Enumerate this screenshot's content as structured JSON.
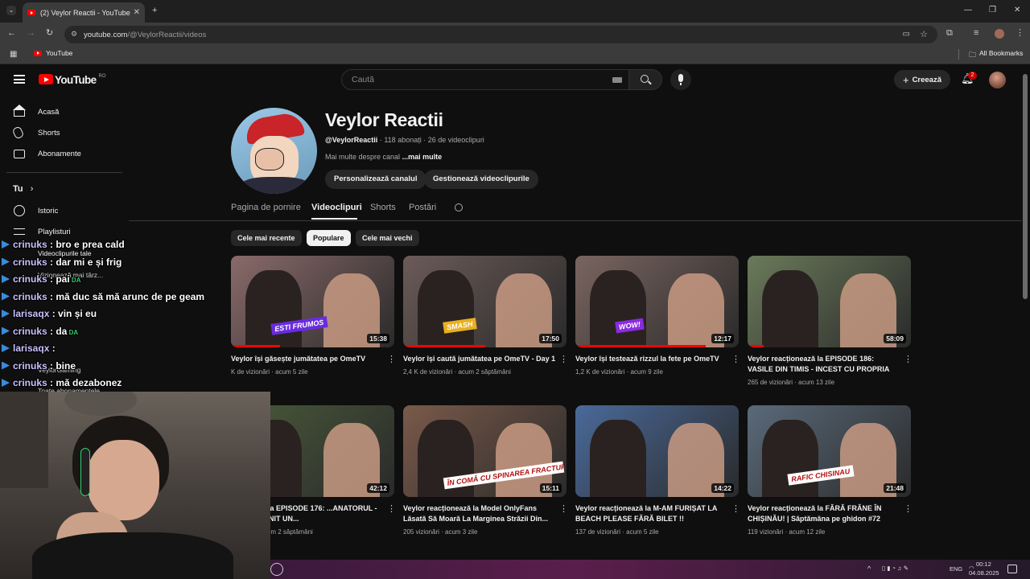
{
  "browser": {
    "tab_title": "(2) Veylor Reactii - YouTube",
    "url_host": "youtube.com",
    "url_path": "/@VeylorReactii/videos",
    "bookmark_youtube": "YouTube",
    "all_bookmarks": "All Bookmarks"
  },
  "yt": {
    "logo_text": "YouTube",
    "region": "RO",
    "search_placeholder": "Caută",
    "create_label": "Creează",
    "notif_count": "2"
  },
  "sidebar": {
    "items": [
      {
        "label": "Acasă"
      },
      {
        "label": "Shorts"
      },
      {
        "label": "Abonamente"
      }
    ],
    "you_label": "Tu",
    "you_items": [
      {
        "label": "Istoric"
      },
      {
        "label": "Playlisturi"
      },
      {
        "label": "Videoclipurile tale"
      },
      {
        "label": "Vizionează mai târz..."
      }
    ],
    "sub_item": "VeylorGaming",
    "all_subs": "Toate abonamentele"
  },
  "channel": {
    "name": "Veylor Reactii",
    "handle": "@VeylorReactii",
    "subs": "118 abonați",
    "videos_count": "26 de videoclipuri",
    "about_text": "Mai multe despre canal",
    "about_more": "...mai multe",
    "btn_customize": "Personalizează canalul",
    "btn_manage": "Gestionează videoclipurile"
  },
  "tabs": [
    "Pagina de pornire",
    "Videoclipuri",
    "Shorts",
    "Postări"
  ],
  "chips": [
    "Cele mai recente",
    "Populare",
    "Cele mai vechi"
  ],
  "sep": "·",
  "videos": [
    {
      "title": "Veylor își găsește jumătatea pe OmeTV",
      "views": "K de vizionări",
      "age": "acum 5 zile",
      "duration": "15:38",
      "progress": 0.3,
      "color": "#8a6a6a",
      "sticker": "ESTI FRUMOS",
      "sticker_color": "#6a2be0"
    },
    {
      "title": "Veylor își caută jumătatea pe OmeTV - Day 1",
      "views": "2,4 K de vizionări",
      "age": "acum 2 săptămâni",
      "duration": "17:50",
      "progress": 0.5,
      "color": "#6b5b58",
      "sticker": "SMASH",
      "sticker_color": "#e8b020"
    },
    {
      "title": "Veylor își testează rizzul la fete pe OmeTV",
      "views": "1,2 K de vizionări",
      "age": "acum 9 zile",
      "duration": "12:17",
      "progress": 0.8,
      "color": "#7a6560",
      "sticker": "WOW!",
      "sticker_color": "#8a2be0"
    },
    {
      "title": "Veylor reacționează la EPISODE 186: VASILE DIN TIMIS - INCEST CU PROPRIA FIICA",
      "views": "265 de vizionări",
      "age": "acum 13 zile",
      "duration": "58:09",
      "progress": 0.1,
      "color": "#6a7a5a",
      "sticker": "",
      "sticker_color": "#000"
    },
    {
      "title": "...ționează la EPISODE 176: ...ANATORUL - AM PREVENIT UN...",
      "views": "vizionări",
      "age": "acum 2 săptămâni",
      "duration": "42:12",
      "progress": 0.0,
      "color": "#4a5a3a",
      "sticker": "",
      "sticker_color": "#000"
    },
    {
      "title": "Veylor reacționează la Model OnlyFans Lăsată Să Moară La Marginea Străzii Din...",
      "views": "205 vizionări",
      "age": "acum 3 zile",
      "duration": "15:11",
      "progress": 0.0,
      "color": "#7a5a4a",
      "sticker": "ÎN COMĂ CU SPINAREA FRACTURATĂ",
      "sticker_color": "#ffffff"
    },
    {
      "title": "Veylor reacționează la M-AM FURIȘAT LA BEACH PLEASE FĂRĂ BILET !!",
      "views": "137 de vizionări",
      "age": "acum 5 zile",
      "duration": "14:22",
      "progress": 0.0,
      "color": "#4a6a9a",
      "sticker": "",
      "sticker_color": "#000"
    },
    {
      "title": "Veylor reacționează la FĂRĂ FRÂNE ÎN CHIȘINĂU! | Săptămâna pe ghidon #72",
      "views": "119 vizionări",
      "age": "acum 12 zile",
      "duration": "21:48",
      "progress": 0.0,
      "color": "#5a6a7a",
      "sticker": "RAFIC CHISINAU",
      "sticker_color": "#ffffff"
    }
  ],
  "chat": [
    {
      "user": "crinuks",
      "msg": ": bro e prea cald",
      "badge": false
    },
    {
      "user": "crinuks",
      "msg": ": dar mi e și frig",
      "badge": false
    },
    {
      "user": "crinuks",
      "msg": ": pai",
      "badge": true
    },
    {
      "user": "crinuks",
      "msg": ": mă duc să mă arunc de pe geam",
      "badge": false
    },
    {
      "user": "larisaqx",
      "msg": ": vin și eu",
      "badge": false
    },
    {
      "user": "crinuks",
      "msg": ": da",
      "badge": true
    },
    {
      "user": "larisaqx",
      "msg": ":",
      "badge": false
    },
    {
      "user": "crinuks",
      "msg": ": bine",
      "badge": false
    },
    {
      "user": "crinuks",
      "msg": ": mă dezabonez",
      "badge": false
    }
  ],
  "chat_badge": "DA",
  "taskbar": {
    "lang": "ENG",
    "time": "00:12",
    "date": "04.08.2025"
  },
  "colors": {
    "bg": "#0f0f0f",
    "accent": "#ff0000",
    "chat_user": "#c9c2ff"
  }
}
